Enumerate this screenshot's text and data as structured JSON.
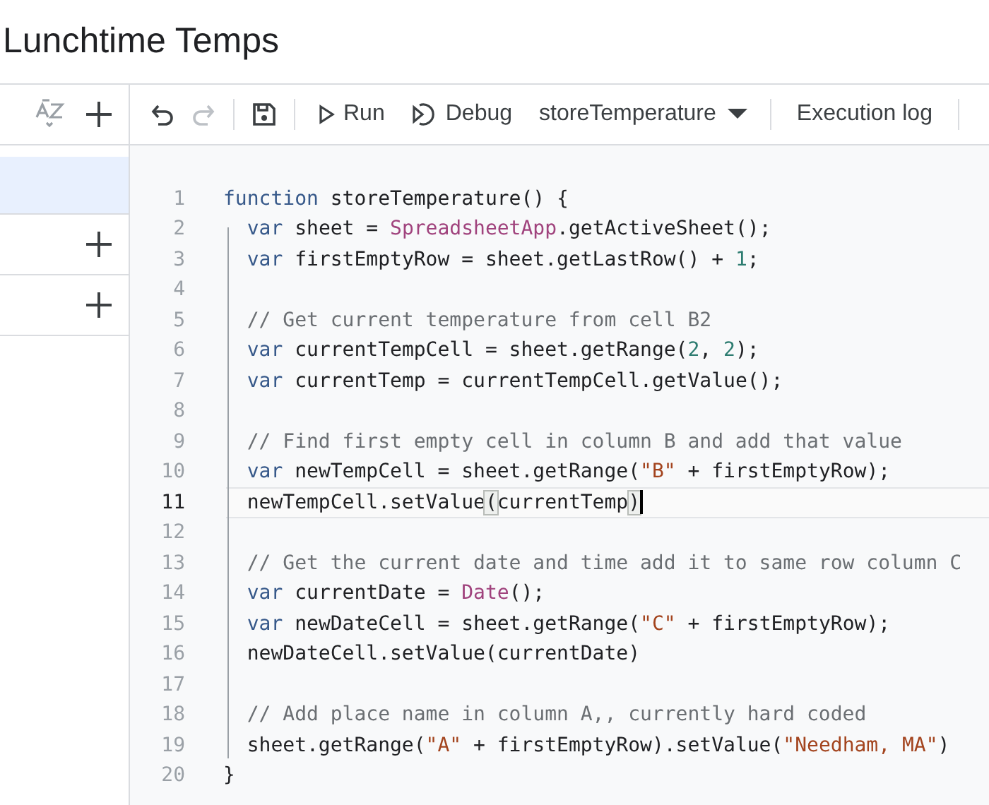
{
  "title": "Lunchtime Temps",
  "sidebar": {
    "tools": [
      {
        "kind": "sort"
      },
      {
        "kind": "add"
      }
    ],
    "items": [
      {
        "kind": "blank",
        "selected": true
      },
      {
        "kind": "add",
        "selected": false
      },
      {
        "kind": "add",
        "selected": false
      }
    ]
  },
  "toolbar": [
    {
      "kind": "undo",
      "disabled": false
    },
    {
      "kind": "redo",
      "disabled": true
    },
    {
      "kind": "divider"
    },
    {
      "kind": "save",
      "disabled": false
    },
    {
      "kind": "divider"
    },
    {
      "kind": "run",
      "label": "Run"
    },
    {
      "kind": "debug",
      "label": "Debug"
    },
    {
      "kind": "dropdown",
      "label": "storeTemperature"
    },
    {
      "kind": "divider"
    },
    {
      "kind": "text",
      "label": "Execution log"
    },
    {
      "kind": "divider"
    }
  ],
  "code": {
    "lines": [
      {
        "number": "1",
        "active": false,
        "tokens": [
          {
            "kind": "kw",
            "text": "function"
          },
          {
            "kind": "plain",
            "text": " storeTemperature() {"
          }
        ]
      },
      {
        "number": "2",
        "active": false,
        "tokens": [
          {
            "kind": "kw",
            "text": "  var"
          },
          {
            "kind": "plain",
            "text": " sheet = "
          },
          {
            "kind": "cls",
            "text": "SpreadsheetApp"
          },
          {
            "kind": "plain",
            "text": ".getActiveSheet();"
          }
        ]
      },
      {
        "number": "3",
        "active": false,
        "tokens": [
          {
            "kind": "kw",
            "text": "  var"
          },
          {
            "kind": "plain",
            "text": " firstEmptyRow = sheet.getLastRow() + "
          },
          {
            "kind": "num",
            "text": "1"
          },
          {
            "kind": "plain",
            "text": ";"
          }
        ]
      },
      {
        "number": "4",
        "active": false
      },
      {
        "number": "5",
        "active": false,
        "tokens": [
          {
            "kind": "com",
            "text": "  // Get current temperature from cell B2"
          }
        ]
      },
      {
        "number": "6",
        "active": false,
        "tokens": [
          {
            "kind": "kw",
            "text": "  var"
          },
          {
            "kind": "plain",
            "text": " currentTempCell = sheet.getRange("
          },
          {
            "kind": "num",
            "text": "2"
          },
          {
            "kind": "plain",
            "text": ", "
          },
          {
            "kind": "num",
            "text": "2"
          },
          {
            "kind": "plain",
            "text": ");"
          }
        ]
      },
      {
        "number": "7",
        "active": false,
        "tokens": [
          {
            "kind": "kw",
            "text": "  var"
          },
          {
            "kind": "plain",
            "text": " currentTemp = currentTempCell.getValue();"
          }
        ]
      },
      {
        "number": "8",
        "active": false
      },
      {
        "number": "9",
        "active": false,
        "tokens": [
          {
            "kind": "com",
            "text": "  // Find first empty cell in column B and add that value"
          }
        ]
      },
      {
        "number": "10",
        "active": false,
        "tokens": [
          {
            "kind": "kw",
            "text": "  var"
          },
          {
            "kind": "plain",
            "text": " newTempCell = sheet.getRange("
          },
          {
            "kind": "str",
            "text": "\"B\""
          },
          {
            "kind": "plain",
            "text": " + firstEmptyRow);"
          }
        ]
      },
      {
        "number": "11",
        "active": true,
        "tokens": [
          {
            "kind": "plain",
            "text": "  newTempCell.setValue"
          },
          {
            "kind": "bracket",
            "text": "("
          },
          {
            "kind": "plain",
            "text": "currentTemp"
          },
          {
            "kind": "bracket",
            "text": ")"
          }
        ]
      },
      {
        "number": "12",
        "active": false
      },
      {
        "number": "13",
        "active": false,
        "tokens": [
          {
            "kind": "com",
            "text": "  // Get the current date and time add it to same row column C"
          }
        ]
      },
      {
        "number": "14",
        "active": false,
        "tokens": [
          {
            "kind": "kw",
            "text": "  var"
          },
          {
            "kind": "plain",
            "text": " currentDate = "
          },
          {
            "kind": "cls",
            "text": "Date"
          },
          {
            "kind": "plain",
            "text": "();"
          }
        ]
      },
      {
        "number": "15",
        "active": false,
        "tokens": [
          {
            "kind": "kw",
            "text": "  var"
          },
          {
            "kind": "plain",
            "text": " newDateCell = sheet.getRange("
          },
          {
            "kind": "str",
            "text": "\"C\""
          },
          {
            "kind": "plain",
            "text": " + firstEmptyRow);"
          }
        ]
      },
      {
        "number": "16",
        "active": false,
        "tokens": [
          {
            "kind": "plain",
            "text": "  newDateCell.setValue(currentDate)"
          }
        ]
      },
      {
        "number": "17",
        "active": false
      },
      {
        "number": "18",
        "active": false,
        "tokens": [
          {
            "kind": "com",
            "text": "  // Add place name in column A,, currently hard coded"
          }
        ]
      },
      {
        "number": "19",
        "active": false,
        "tokens": [
          {
            "kind": "plain",
            "text": "  sheet.getRange("
          },
          {
            "kind": "str",
            "text": "\"A\""
          },
          {
            "kind": "plain",
            "text": " + firstEmptyRow).setValue("
          },
          {
            "kind": "str",
            "text": "\"Needham, MA\""
          },
          {
            "kind": "plain",
            "text": ")"
          }
        ]
      },
      {
        "number": "20",
        "active": false,
        "tokens": [
          {
            "kind": "plain",
            "text": "}"
          }
        ]
      }
    ]
  }
}
